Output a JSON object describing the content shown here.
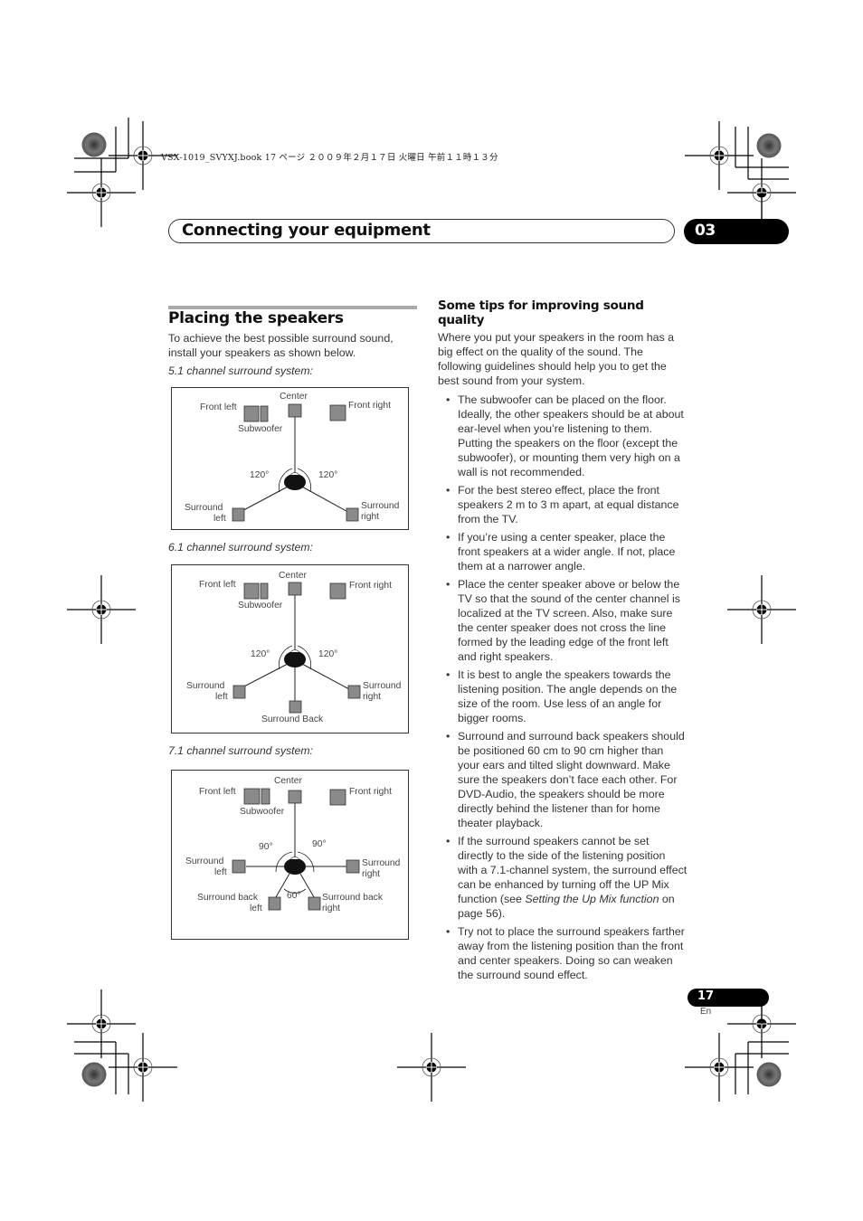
{
  "slug": "VSX-1019_SVYXJ.book   17 ページ   ２００９年２月１７日   火曜日   午前１１時１３分",
  "header": {
    "title": "Connecting your equipment",
    "chapter": "03"
  },
  "left": {
    "section_title": "Placing the speakers",
    "intro": "To achieve the best possible surround sound, install your speakers as shown below.",
    "diagrams": [
      {
        "caption": "5.1 channel surround system:",
        "labels": {
          "center": "Center",
          "front_left": "Front left",
          "front_right": "Front right",
          "subwoofer": "Subwoofer",
          "angle_left": "120°",
          "angle_right": "120°",
          "surround_left_1": "Surround",
          "surround_left_2": "left",
          "surround_right_1": "Surround",
          "surround_right_2": "right"
        }
      },
      {
        "caption": "6.1 channel surround system:",
        "labels": {
          "center": "Center",
          "front_left": "Front left",
          "front_right": "Front right",
          "subwoofer": "Subwoofer",
          "angle_left": "120°",
          "angle_right": "120°",
          "surround_left_1": "Surround",
          "surround_left_2": "left",
          "surround_right_1": "Surround",
          "surround_right_2": "right",
          "surround_back": "Surround Back"
        }
      },
      {
        "caption": "7.1 channel surround system:",
        "labels": {
          "center": "Center",
          "front_left": "Front left",
          "front_right": "Front right",
          "subwoofer": "Subwoofer",
          "angle_left": "90°",
          "angle_right": "90°",
          "angle_back": "60°",
          "surround_left_1": "Surround",
          "surround_left_2": "left",
          "surround_right_1": "Surround",
          "surround_right_2": "right",
          "surround_back_left_1": "Surround back",
          "surround_back_left_2": "left",
          "surround_back_right_1": "Surround back",
          "surround_back_right_2": "right"
        }
      }
    ]
  },
  "right": {
    "title": "Some tips for improving sound quality",
    "intro": "Where you put your speakers in the room has a big effect on the quality of the sound. The following guidelines should help you to get the best sound from your system.",
    "bullet": "•",
    "tips": [
      "The subwoofer can be placed on the floor. Ideally, the other speakers should be at about ear-level when you’re listening to them. Putting the speakers on the floor (except the subwoofer), or mounting them very high on a wall is not recommended.",
      "For the best stereo effect, place the front speakers 2 m to 3 m apart, at equal distance from the TV.",
      "If you’re using a center speaker, place the front speakers at a wider angle. If not, place them at a narrower angle.",
      "Place the center speaker above or below the TV so that the sound of the center channel is localized at the TV screen. Also, make sure the center speaker does not cross the line formed by the leading edge of the front left and right speakers.",
      "It is best to angle the speakers towards the listening position. The angle depends on the size of the room. Use less of an angle for bigger rooms.",
      "Surround and surround back speakers should be positioned 60 cm to 90 cm higher than your ears and tilted slight downward. Make sure the speakers don’t face each other. For DVD-Audio, the speakers should be more directly behind the listener than for home theater playback."
    ],
    "tip_upmix": {
      "before": "If the surround speakers cannot be set directly to the side of the listening position with a 7.1-channel system, the surround effect can be enhanced by turning off the UP Mix function (see ",
      "link": "Setting the Up Mix function",
      "after": " on page 56)."
    },
    "tip_last": "Try not to place the surround speakers farther away from the listening position than the front and center speakers. Doing so can weaken the surround sound effect."
  },
  "footer": {
    "page_number": "17",
    "language": "En"
  },
  "colors": {
    "speaker_fill": "#8a8a8a",
    "chapter_pill": "#000000",
    "rule": "#aaaaaa"
  }
}
